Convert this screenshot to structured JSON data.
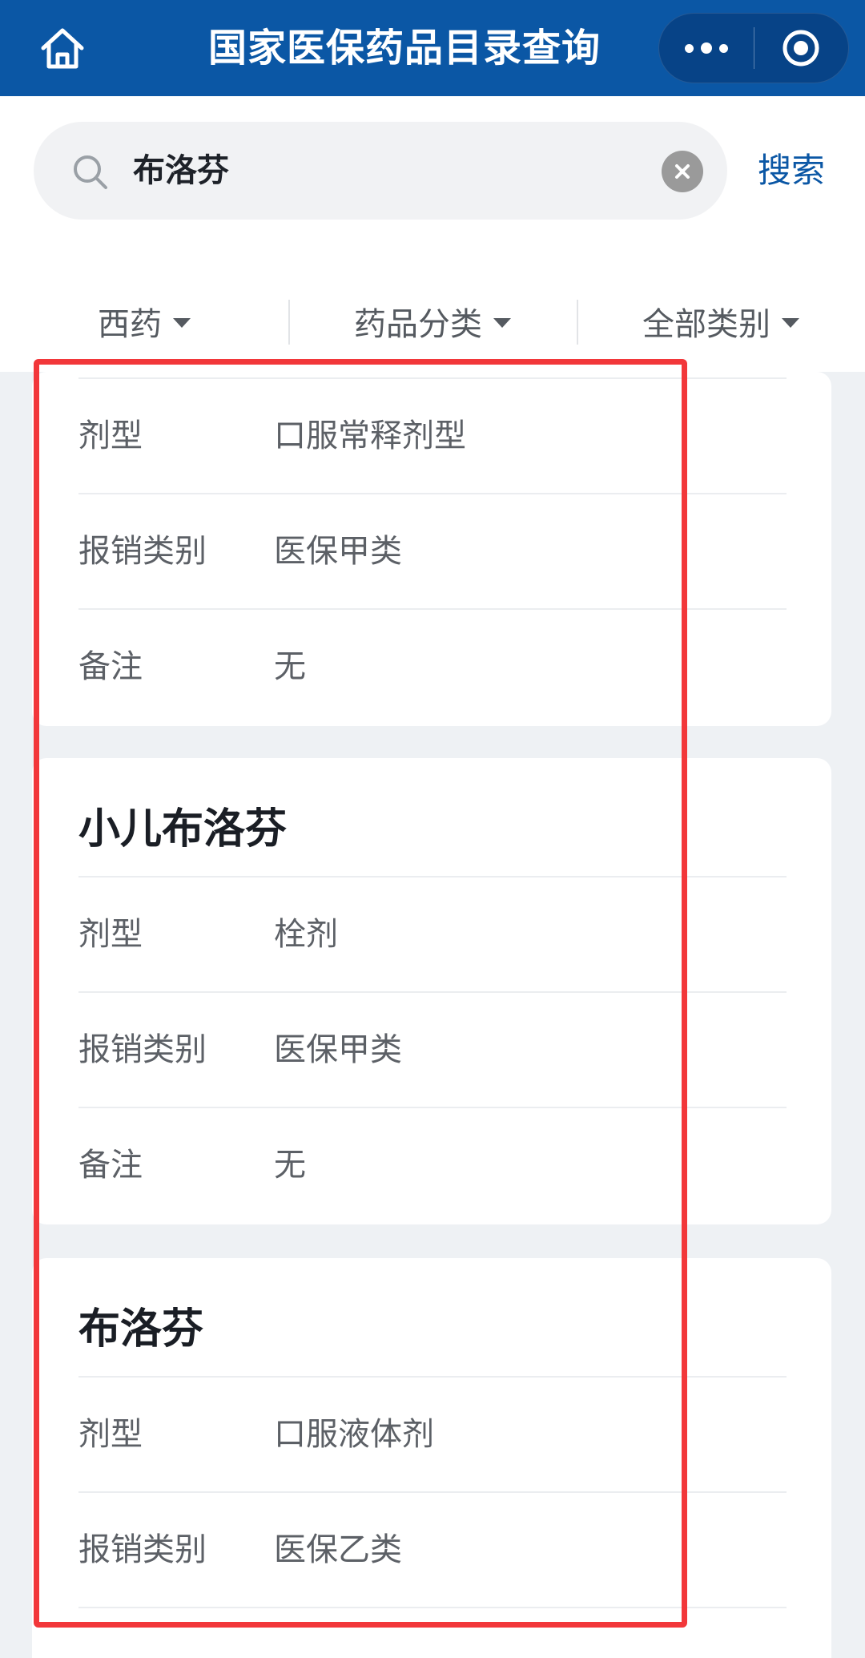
{
  "navbar": {
    "title": "国家医保药品目录查询",
    "home_icon": "home-icon",
    "more_icon": "more-dots-icon",
    "target_icon": "target-icon"
  },
  "search": {
    "value": "布洛芬",
    "search_label": "搜索",
    "search_icon": "search-icon",
    "clear_icon": "clear-icon"
  },
  "filters": [
    {
      "label": "西药"
    },
    {
      "label": "药品分类"
    },
    {
      "label": "全部类别"
    }
  ],
  "cards": [
    {
      "title": "",
      "rows": [
        {
          "label": "剂型",
          "value": "口服常释剂型"
        },
        {
          "label": "报销类别",
          "value": "医保甲类"
        },
        {
          "label": "备注",
          "value": "无"
        }
      ]
    },
    {
      "title": "小儿布洛芬",
      "rows": [
        {
          "label": "剂型",
          "value": "栓剂"
        },
        {
          "label": "报销类别",
          "value": "医保甲类"
        },
        {
          "label": "备注",
          "value": "无"
        }
      ]
    },
    {
      "title": "布洛芬",
      "rows": [
        {
          "label": "剂型",
          "value": "口服液体剂"
        },
        {
          "label": "报销类别",
          "value": "医保乙类"
        }
      ]
    }
  ],
  "colors": {
    "brand": "#0b57a5",
    "highlight": "#f2373a"
  }
}
